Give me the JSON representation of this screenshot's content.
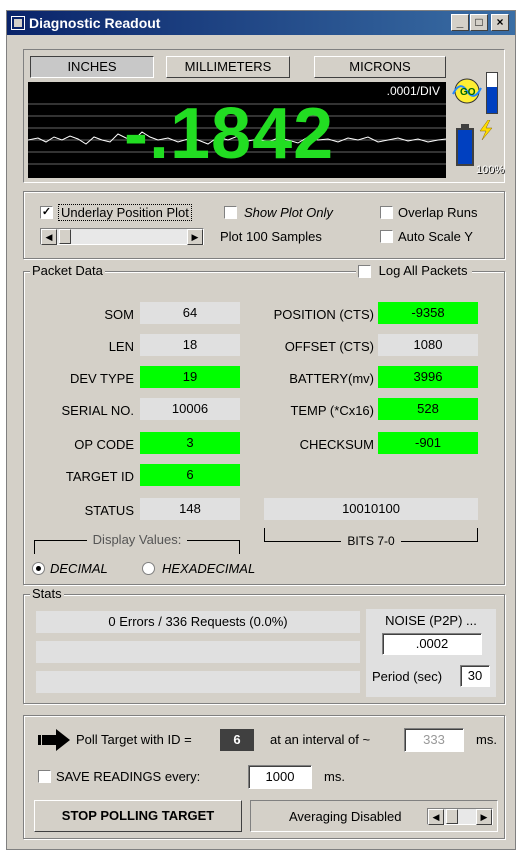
{
  "window": {
    "title": "Diagnostic Readout"
  },
  "units": {
    "inches": "INCHES",
    "millimeters": "MILLIMETERS",
    "microns": "MICRONS",
    "selected": "INCHES"
  },
  "display": {
    "scale": ".0001/DIV",
    "reading": "-.1842",
    "battery_percent": "100%",
    "battery_level": 1.0,
    "signal_label": "GO"
  },
  "plot_options": {
    "underlay_label": "Underlay Position  Plot",
    "underlay_checked": true,
    "show_plot_only_label": "Show Plot Only",
    "overlap_runs_label": "Overlap Runs",
    "auto_scale_label": "Auto Scale Y",
    "samples_label": "Plot 100 Samples"
  },
  "packet": {
    "group_label": "Packet Data",
    "log_all_label": "Log All Packets",
    "left_fields": [
      {
        "label": "SOM",
        "value": "64",
        "green": false
      },
      {
        "label": "LEN",
        "value": "18",
        "green": false
      },
      {
        "label": "DEV TYPE",
        "value": "19",
        "green": true
      },
      {
        "label": "SERIAL NO.",
        "value": "10006",
        "green": false
      },
      {
        "label": "OP CODE",
        "value": "3",
        "green": true
      },
      {
        "label": "TARGET ID",
        "value": "6",
        "green": true
      },
      {
        "label": "STATUS",
        "value": "148",
        "green": false
      }
    ],
    "right_fields": [
      {
        "label": "POSITION (CTS)",
        "value": "-9358",
        "green": true
      },
      {
        "label": "OFFSET (CTS)",
        "value": "1080",
        "green": false
      },
      {
        "label": "BATTERY(mv)",
        "value": "3996",
        "green": true
      },
      {
        "label": "TEMP (*Cx16)",
        "value": "528",
        "green": true
      },
      {
        "label": "CHECKSUM",
        "value": "-901",
        "green": true
      }
    ],
    "bits_value": "10010100",
    "bits_label": "BITS 7-0",
    "display_values_label": "Display Values:",
    "decimal_label": "DECIMAL",
    "hex_label": "HEXADECIMAL"
  },
  "stats": {
    "group_label": "Stats",
    "summary": "0 Errors / 336 Requests (0.0%)",
    "noise_label": "NOISE (P2P) ...",
    "noise_value": ".0002",
    "period_label": "Period (sec)",
    "period_value": "30"
  },
  "poll": {
    "poll_label": "Poll Target with ID =",
    "target_id": "6",
    "interval_label": "at an interval of ~",
    "interval_value": "333",
    "ms": "ms.",
    "save_label": "SAVE READINGS every:",
    "save_value": "1000",
    "save_ms": "ms.",
    "stop_button": "STOP POLLING TARGET",
    "averaging_label": "Averaging Disabled"
  },
  "colors": {
    "accent_green": "#00ff00",
    "title_blue": "#0a246a",
    "display_bg": "#000000"
  }
}
